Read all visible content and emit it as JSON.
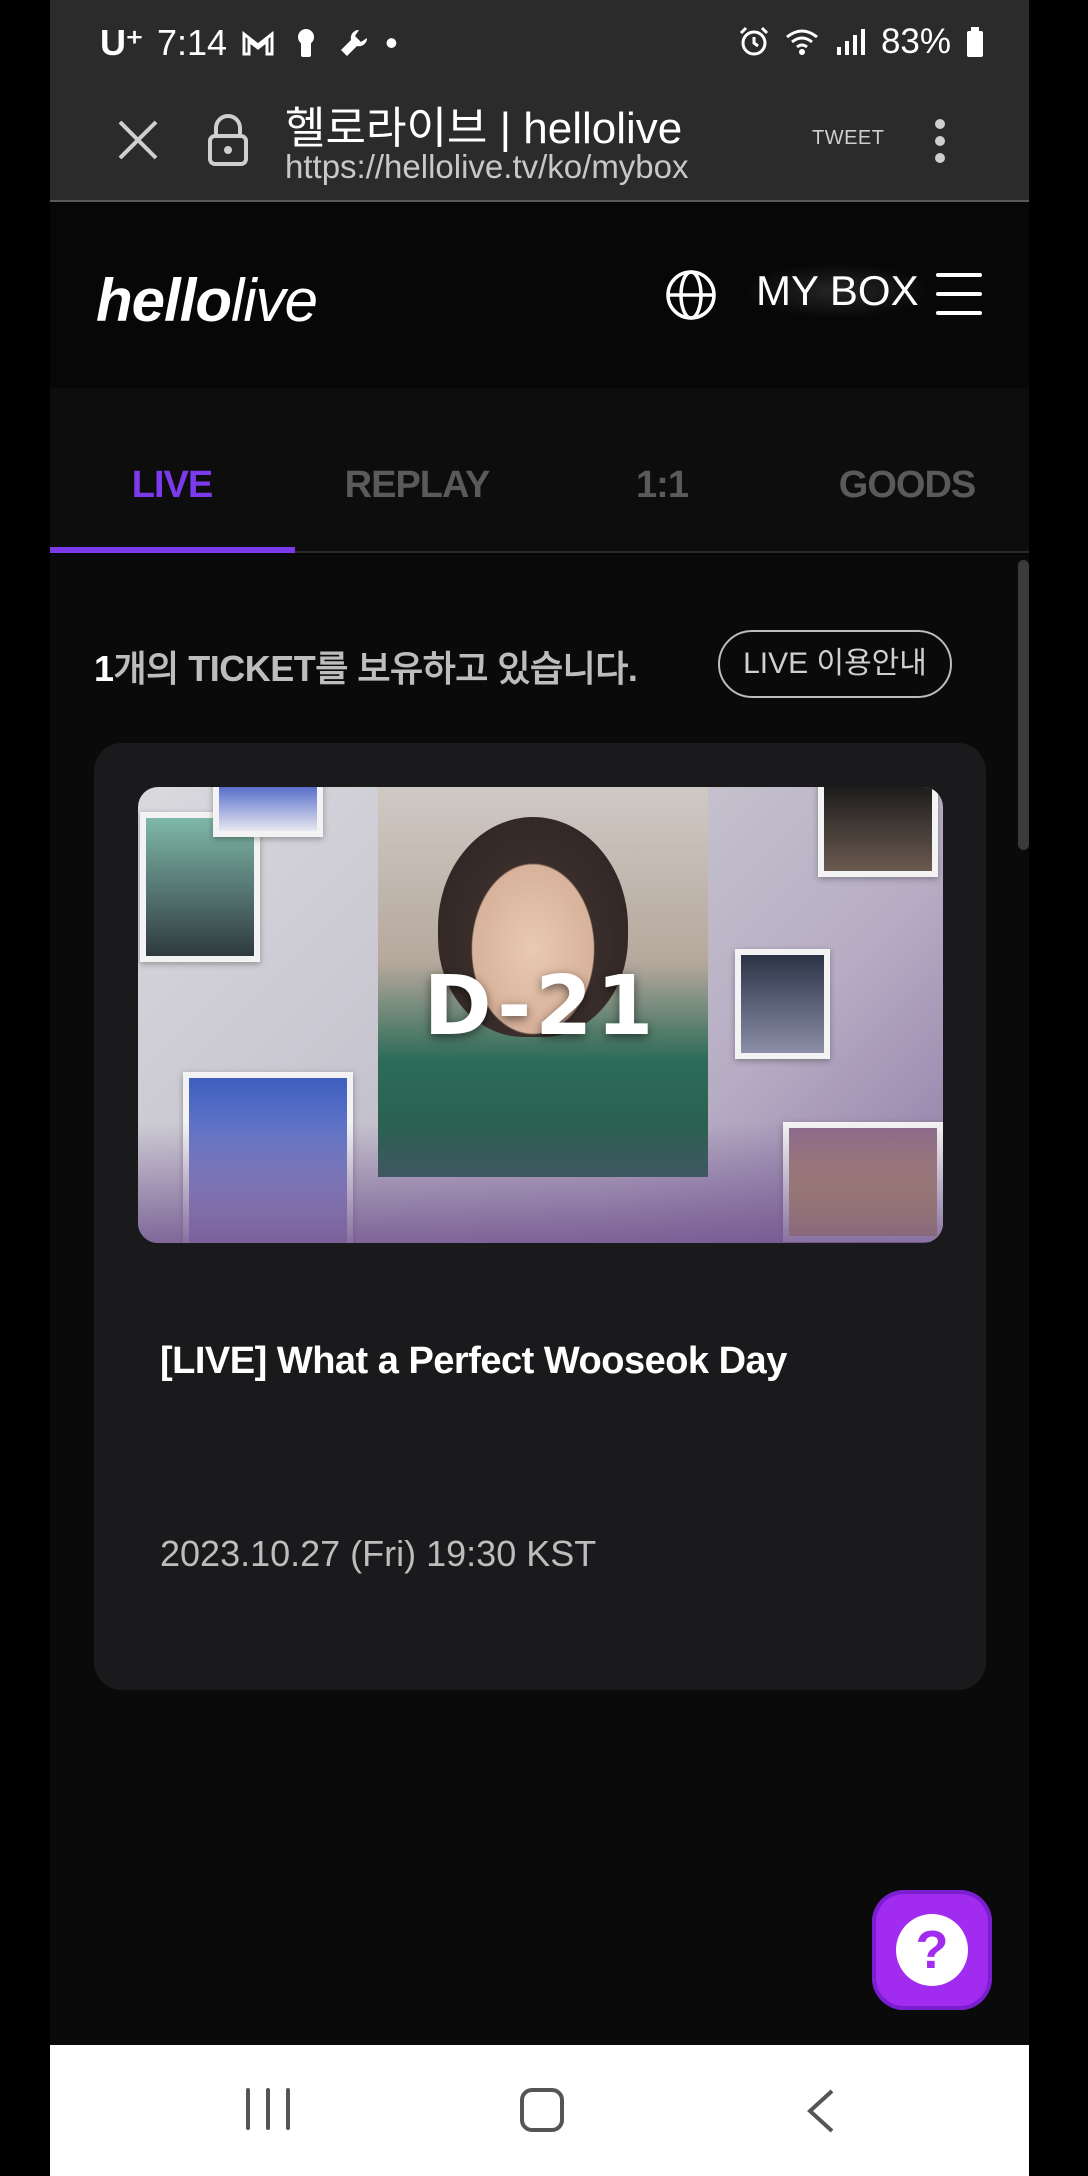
{
  "status_bar": {
    "carrier": "U⁺",
    "time": "7:14",
    "dot": "•",
    "battery": "83%"
  },
  "browser": {
    "title": "헬로라이브 | hellolive",
    "url": "https://hellolive.tv/ko/mybox",
    "tweet_label": "TWEET"
  },
  "site_header": {
    "logo_bold": "hello",
    "logo_light": "live",
    "mybox_label": "MY BOX"
  },
  "tabs": [
    {
      "label": "LIVE",
      "active": true
    },
    {
      "label": "REPLAY",
      "active": false
    },
    {
      "label": "1:1",
      "active": false
    },
    {
      "label": "GOODS",
      "active": false
    }
  ],
  "tickets": {
    "count": "1",
    "text": "개의 TICKET를 보유하고 있습니다.",
    "guide_button": "LIVE 이용안내"
  },
  "card": {
    "d_day": "D-21",
    "title": "[LIVE] What a Perfect Wooseok Day",
    "date": "2023.10.27 (Fri) 19:30 KST"
  },
  "help_button": {
    "symbol": "?"
  },
  "colors": {
    "accent": "#7c3aed",
    "help_button": "#a12cf0"
  }
}
